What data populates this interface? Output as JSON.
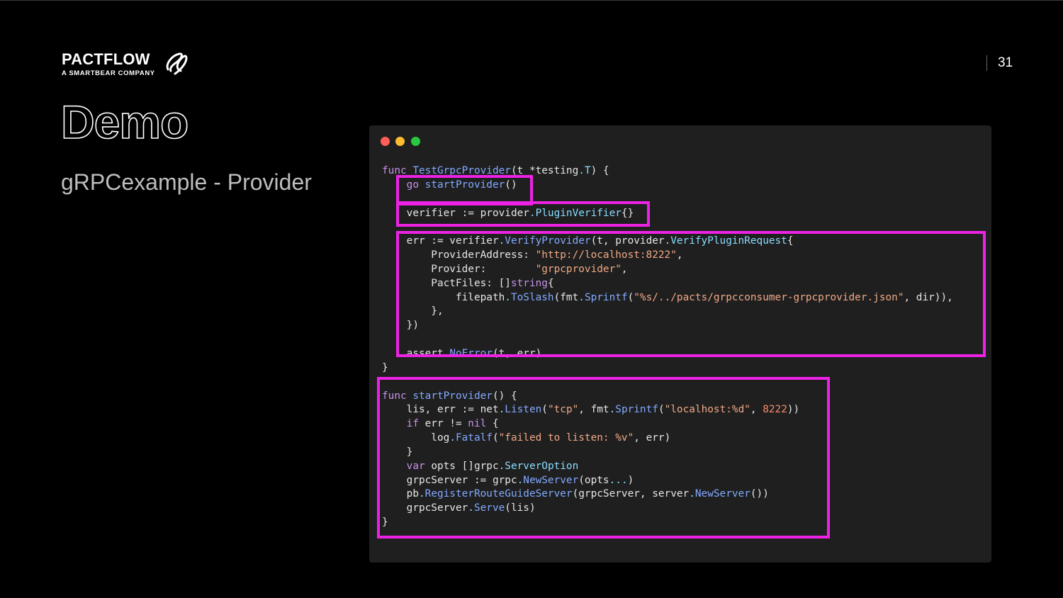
{
  "logo": {
    "name": "PACTFLOW",
    "tagline": "A SMARTBEAR COMPANY"
  },
  "slide_number": "31",
  "title": "Demo",
  "subtitle": "gRPCexample - Provider",
  "colors": {
    "background": "#000000",
    "code_bg": "#1f1f1f",
    "highlight": "#ee22e6"
  },
  "code_lines": [
    "func TestGrpcProvider(t *testing.T) {",
    "    go startProvider()",
    "",
    "    verifier := provider.PluginVerifier{}",
    "",
    "    err := verifier.VerifyProvider(t, provider.VerifyPluginRequest{",
    "        ProviderAddress: \"http://localhost:8222\",",
    "        Provider:        \"grpcprovider\",",
    "        PactFiles: []string{",
    "            filepath.ToSlash(fmt.Sprintf(\"%s/../pacts/grpcconsumer-grpcprovider.json\", dir)),",
    "        },",
    "    })",
    "",
    "    assert.NoError(t, err)",
    "}",
    "",
    "func startProvider() {",
    "    lis, err := net.Listen(\"tcp\", fmt.Sprintf(\"localhost:%d\", 8222))",
    "    if err != nil {",
    "        log.Fatalf(\"failed to listen: %v\", err)",
    "    }",
    "    var opts []grpc.ServerOption",
    "    grpcServer := grpc.NewServer(opts...)",
    "    pb.RegisterRouteGuideServer(grpcServer, server.NewServer())",
    "    grpcServer.Serve(lis)",
    "}"
  ]
}
